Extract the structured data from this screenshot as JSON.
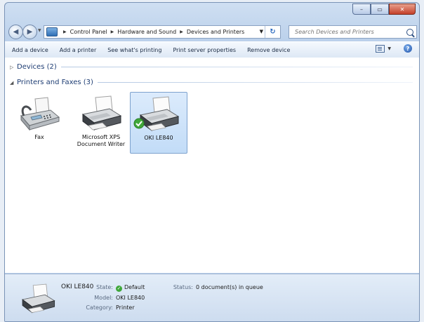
{
  "window": {
    "controls": {
      "minimize": "–",
      "maximize": "▭",
      "close": "✕"
    }
  },
  "nav": {
    "back_icon": "back-arrow-icon",
    "forward_icon": "forward-arrow-icon"
  },
  "address": {
    "crumbs": [
      "Control Panel",
      "Hardware and Sound",
      "Devices and Printers"
    ]
  },
  "search": {
    "placeholder": "Search Devices and Printers"
  },
  "commands": [
    "Add a device",
    "Add a printer",
    "See what's printing",
    "Print server properties",
    "Remove device"
  ],
  "groups": {
    "devices": {
      "label": "Devices (2)",
      "expanded": false
    },
    "printers": {
      "label": "Printers and Faxes (3)",
      "expanded": true
    }
  },
  "printers": [
    {
      "label": "Fax",
      "icon": "fax-machine-icon",
      "selected": false
    },
    {
      "label": "Microsoft XPS Document Writer",
      "icon": "printer-icon",
      "selected": false
    },
    {
      "label": "OKI LE840",
      "icon": "printer-icon",
      "selected": true,
      "default": true
    }
  ],
  "details": {
    "name": "OKI LE840",
    "state_label": "State:",
    "state_value": "Default",
    "model_label": "Model:",
    "model_value": "OKI LE840",
    "category_label": "Category:",
    "category_value": "Printer",
    "status_label": "Status:",
    "status_value": "0 document(s) in queue"
  },
  "colors": {
    "accent": "#1e3d73",
    "selected_bg": "#c2dcf7",
    "default_check": "#3fa73a"
  }
}
